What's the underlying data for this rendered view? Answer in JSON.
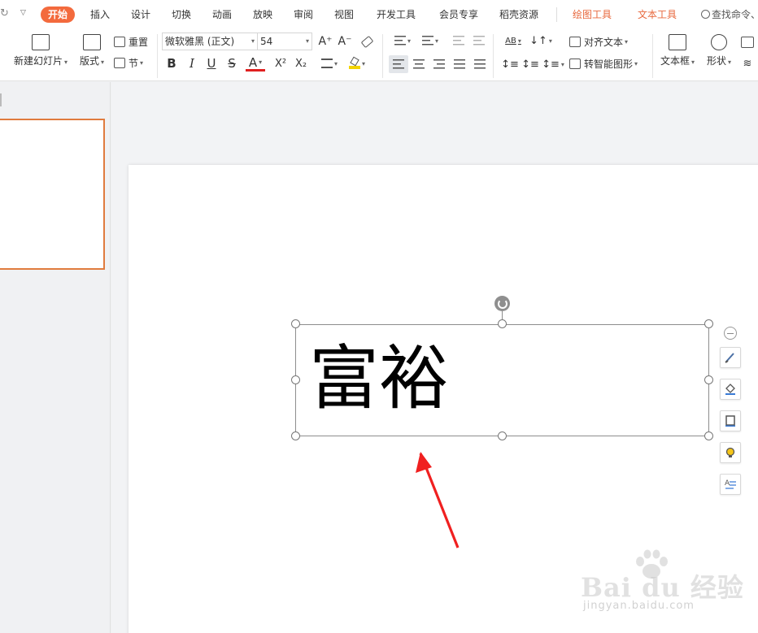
{
  "tabs": {
    "start": "开始",
    "insert": "插入",
    "design": "设计",
    "transition": "切换",
    "animation": "动画",
    "slideshow": "放映",
    "review": "审阅",
    "view": "视图",
    "developer": "开发工具",
    "member": "会员专享",
    "docer": "稻壳资源",
    "drawing_tools": "绘图工具",
    "text_tools": "文本工具",
    "search": "查找命令、"
  },
  "ribbon": {
    "new_slide": "新建幻灯片",
    "layout": "版式",
    "reset": "重置",
    "section": "节",
    "font_name": "微软雅黑 (正文)",
    "font_size": "54",
    "bold": "B",
    "italic": "I",
    "underline": "U",
    "strike": "S",
    "font_color": "A",
    "superscript": "X²",
    "subscript": "X₂",
    "grow_font": "A⁺",
    "shrink_font": "A⁻",
    "text_direction": "AB",
    "align_text": "对齐文本",
    "smart_shape": "转智能图形",
    "textbox": "文本框",
    "shape": "形状"
  },
  "slide": {
    "text": "富裕"
  },
  "watermark": {
    "brand": "Bai du 经验",
    "url": "jingyan.baidu.com"
  },
  "colors": {
    "accent": "#f36a3d",
    "tab_orange": "#e8693e",
    "thumb_border": "#e07b3e",
    "arrow": "#f02020"
  }
}
